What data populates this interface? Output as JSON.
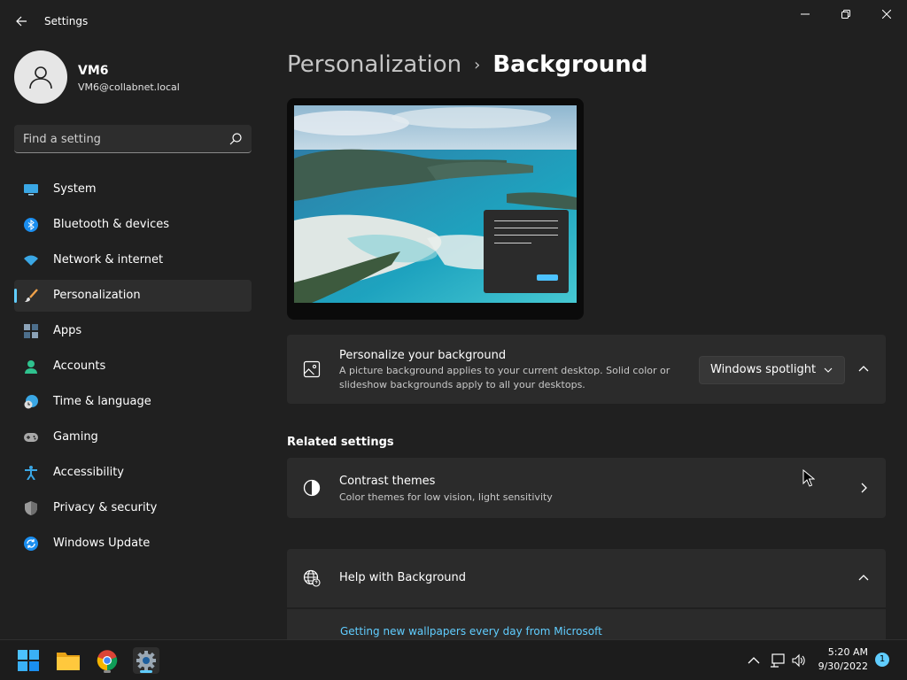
{
  "window": {
    "title": "Settings"
  },
  "account": {
    "name": "VM6",
    "email": "VM6@collabnet.local"
  },
  "search": {
    "placeholder": "Find a setting"
  },
  "nav": {
    "items": [
      {
        "label": "System",
        "icon": "monitor-icon",
        "selected": false
      },
      {
        "label": "Bluetooth & devices",
        "icon": "bluetooth-icon",
        "selected": false
      },
      {
        "label": "Network & internet",
        "icon": "wifi-icon",
        "selected": false
      },
      {
        "label": "Personalization",
        "icon": "brush-icon",
        "selected": true
      },
      {
        "label": "Apps",
        "icon": "apps-icon",
        "selected": false
      },
      {
        "label": "Accounts",
        "icon": "person-icon",
        "selected": false
      },
      {
        "label": "Time & language",
        "icon": "clock-globe-icon",
        "selected": false
      },
      {
        "label": "Gaming",
        "icon": "gamepad-icon",
        "selected": false
      },
      {
        "label": "Accessibility",
        "icon": "accessibility-icon",
        "selected": false
      },
      {
        "label": "Privacy & security",
        "icon": "shield-icon",
        "selected": false
      },
      {
        "label": "Windows Update",
        "icon": "update-icon",
        "selected": false
      }
    ]
  },
  "breadcrumb": {
    "parent": "Personalization",
    "separator": "›",
    "current": "Background"
  },
  "background_card": {
    "title": "Personalize your background",
    "description_line1": "A picture background applies to your current desktop. Solid color or",
    "description_line2": "slideshow backgrounds apply to all your desktops.",
    "dropdown_value": "Windows spotlight",
    "expanded": true
  },
  "related": {
    "heading": "Related settings",
    "contrast": {
      "title": "Contrast themes",
      "description": "Color themes for low vision, light sensitivity"
    }
  },
  "help": {
    "title": "Help with Background",
    "link": "Getting new wallpapers every day from Microsoft"
  },
  "taskbar": {
    "apps": [
      "start-icon",
      "file-explorer-icon",
      "chrome-icon",
      "settings-icon"
    ],
    "time": "5:20 AM",
    "date": "9/30/2022",
    "notification_count": "1"
  },
  "colors": {
    "accent": "#60cdff",
    "background": "#202020",
    "card": "#2b2b2b"
  }
}
